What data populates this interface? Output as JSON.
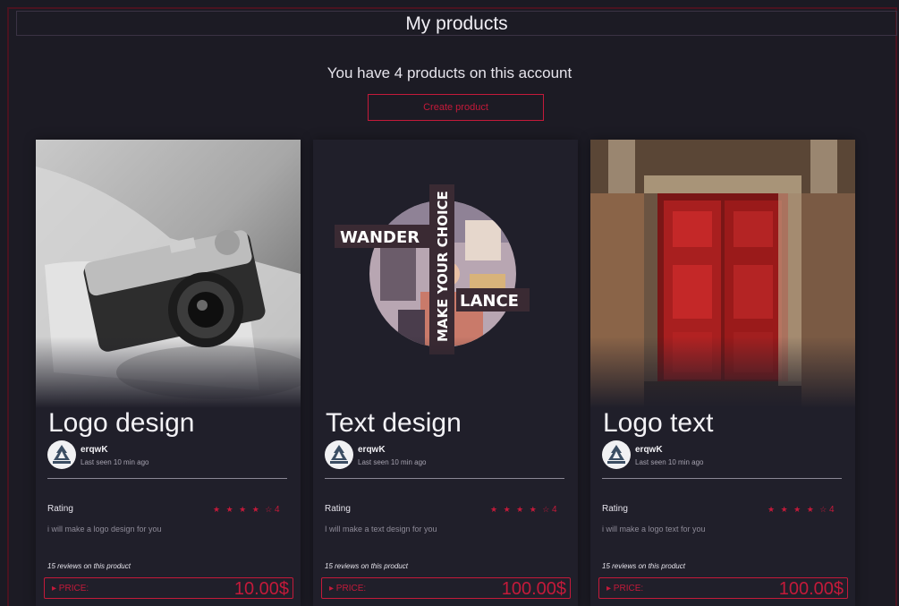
{
  "header": {
    "title": "My products"
  },
  "summary": {
    "text": "You have 4 products on this account"
  },
  "actions": {
    "create_label": "Create product"
  },
  "colors": {
    "accent": "#c41a3a",
    "background": "#1b1a23",
    "card": "#201f2a"
  },
  "products": [
    {
      "title": "Logo design",
      "image": "camera-photo",
      "seller": {
        "name": "erqwK",
        "last_seen": "Last seen 10 min ago"
      },
      "rating_label": "Rating",
      "stars": "★ ★ ★ ★ ☆",
      "rating": "4",
      "description": "i will make a logo design for you",
      "reviews": "15 reviews on this product",
      "price_label": "▸ PRICE:",
      "price": "10.00$"
    },
    {
      "title": "Text design",
      "image": "wanderlance-logo",
      "seller": {
        "name": "erqwK",
        "last_seen": "Last seen 10 min ago"
      },
      "rating_label": "Rating",
      "stars": "★ ★ ★ ★ ☆",
      "rating": "4",
      "description": "I will make a text design for you",
      "reviews": "15 reviews on this product",
      "price_label": "▸ PRICE:",
      "price": "100.00$"
    },
    {
      "title": "Logo text",
      "image": "red-door-photo",
      "seller": {
        "name": "erqwK",
        "last_seen": "Last seen 10 min ago"
      },
      "rating_label": "Rating",
      "stars": "★ ★ ★ ★ ☆",
      "rating": "4",
      "description": "i will make a logo text for you",
      "reviews": "15 reviews on this product",
      "price_label": "▸ PRICE:",
      "price": "100.00$"
    }
  ],
  "logo_image": {
    "word_left": "WANDER",
    "word_vertical": "MAKE YOUR CHOICE",
    "word_right": "LANCE"
  }
}
